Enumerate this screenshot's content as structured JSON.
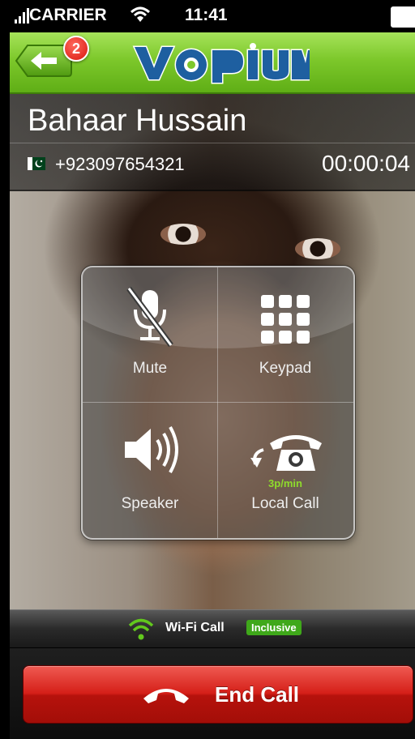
{
  "status_bar": {
    "carrier": "CARRIER",
    "time": "11:41"
  },
  "nav": {
    "badge_count": "2",
    "logo_text": "vopium",
    "accent": "#7dc82b"
  },
  "contact": {
    "name": "Bahaar Hussain",
    "phone": "+923097654321",
    "duration": "00:00:04",
    "flag": "pakistan-flag-icon"
  },
  "controls": [
    {
      "label": "Mute",
      "icon": "microphone-muted-icon"
    },
    {
      "label": "Keypad",
      "icon": "keypad-icon"
    },
    {
      "label": "Speaker",
      "icon": "speaker-icon"
    },
    {
      "label": "Local Call",
      "icon": "local-call-phone-icon",
      "rate": "3p/min"
    }
  ],
  "connection": {
    "label": "Wi-Fi Call",
    "tag": "Inclusive"
  },
  "end_call": {
    "label": "End Call",
    "color": "#d51f18"
  }
}
